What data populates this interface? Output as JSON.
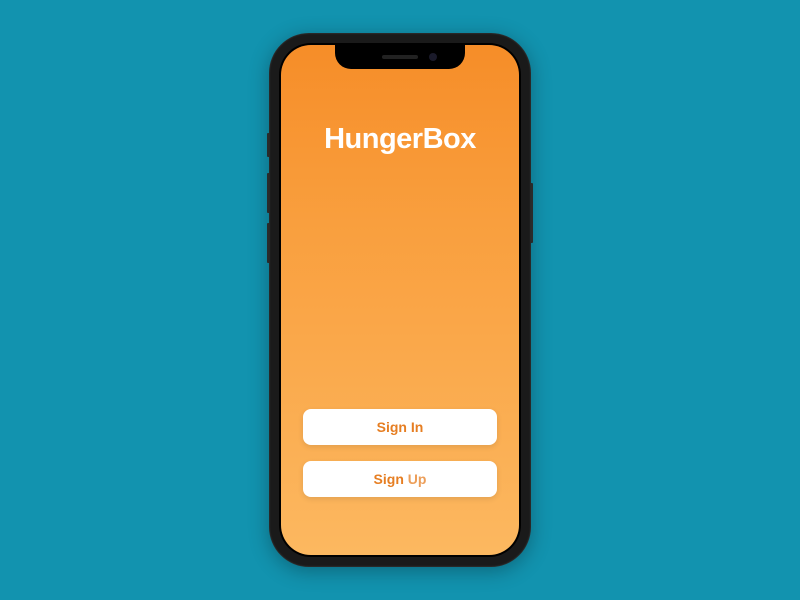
{
  "app": {
    "name": "HungerBox"
  },
  "buttons": {
    "signin_label": "Sign In",
    "signup_label": "Sign Up"
  },
  "colors": {
    "background": "#1293af",
    "gradient_top": "#f68d28",
    "gradient_bottom": "#fcb860",
    "button_text": "#e67e22"
  }
}
